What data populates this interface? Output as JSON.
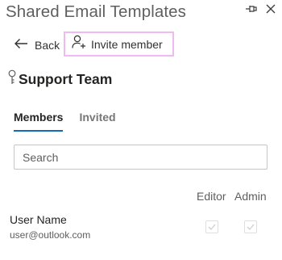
{
  "pane": {
    "title": "Shared Email Templates"
  },
  "toolbar": {
    "back_label": "Back",
    "invite_label": "Invite member"
  },
  "team": {
    "name": "Support Team"
  },
  "tabs": [
    {
      "label": "Members",
      "active": true
    },
    {
      "label": "Invited",
      "active": false
    }
  ],
  "search": {
    "placeholder": "Search",
    "value": ""
  },
  "columns": {
    "editor": "Editor",
    "admin": "Admin"
  },
  "members": [
    {
      "name": "User Name",
      "email": "user@outlook.com",
      "editor": true,
      "admin": true
    }
  ],
  "colors": {
    "accent": "#0f6cbd",
    "highlight_border": "#f0b9f0"
  }
}
